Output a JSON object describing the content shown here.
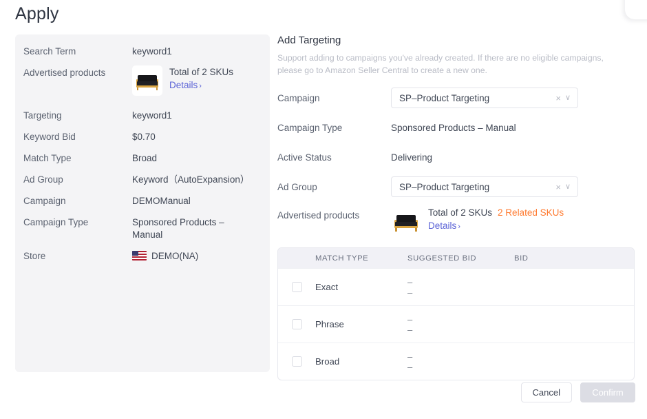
{
  "page": {
    "title": "Apply"
  },
  "summary": {
    "rows": [
      {
        "label": "Search Term",
        "value": "keyword1",
        "type": "text"
      },
      {
        "label": "Advertised products",
        "value": "",
        "type": "product"
      },
      {
        "label": "Targeting",
        "value": "keyword1",
        "type": "text"
      },
      {
        "label": "Keyword Bid",
        "value": "$0.70",
        "type": "text"
      },
      {
        "label": "Match Type",
        "value": "Broad",
        "type": "text"
      },
      {
        "label": "Ad Group",
        "value": "Keyword（AutoExpansion）",
        "type": "text"
      },
      {
        "label": "Campaign",
        "value": "DEMOManual",
        "type": "text"
      },
      {
        "label": "Campaign Type",
        "value": "Sponsored Products –\nManual",
        "type": "text"
      },
      {
        "label": "Store",
        "value": "DEMO(NA)",
        "type": "store"
      }
    ],
    "product": {
      "sku_text": "Total of 2 SKUs",
      "details_label": "Details",
      "details_chevron": "›",
      "image_name": "futon-sofa-thumbnail"
    },
    "store_flag": "us-flag-icon"
  },
  "targeting": {
    "title": "Add Targeting",
    "description": "Support adding to campaigns you've already created. If there are no eligible campaigns, please go to Amazon Seller Central to create a new one.",
    "fields": [
      {
        "label": "Campaign",
        "type": "select",
        "value": "SP–Product Targeting"
      },
      {
        "label": "Campaign Type",
        "type": "text",
        "value": "Sponsored Products – Manual"
      },
      {
        "label": "Active Status",
        "type": "text",
        "value": "Delivering"
      },
      {
        "label": "Ad Group",
        "type": "select",
        "value": "SP–Product Targeting"
      }
    ],
    "advertised": {
      "label": "Advertised products",
      "sku_text": "Total of 2 SKUs",
      "related_skus": "2 Related SKUs",
      "details_label": "Details",
      "details_chevron": "›",
      "image_name": "futon-sofa-thumbnail"
    },
    "select_icons": {
      "clear": "×",
      "chevron": "∨"
    }
  },
  "table": {
    "columns": [
      "MATCH TYPE",
      "SUGGESTED BID",
      "BID"
    ],
    "rows": [
      {
        "checked": false,
        "match_type": "Exact",
        "suggested_bid": [
          "–",
          "–"
        ],
        "bid": ""
      },
      {
        "checked": false,
        "match_type": "Phrase",
        "suggested_bid": [
          "–",
          "–"
        ],
        "bid": ""
      },
      {
        "checked": false,
        "match_type": "Broad",
        "suggested_bid": [
          "–",
          "–"
        ],
        "bid": ""
      }
    ]
  },
  "footer": {
    "cancel_label": "Cancel",
    "confirm_label": "Confirm",
    "confirm_disabled": true
  },
  "colors": {
    "accent_orange": "#ff7a2f",
    "link_blue": "#5a62d6",
    "card_bg": "#f4f4f6",
    "table_header_bg": "#f1f1f6",
    "text_primary": "#3f4654",
    "text_label": "#5b6270"
  }
}
